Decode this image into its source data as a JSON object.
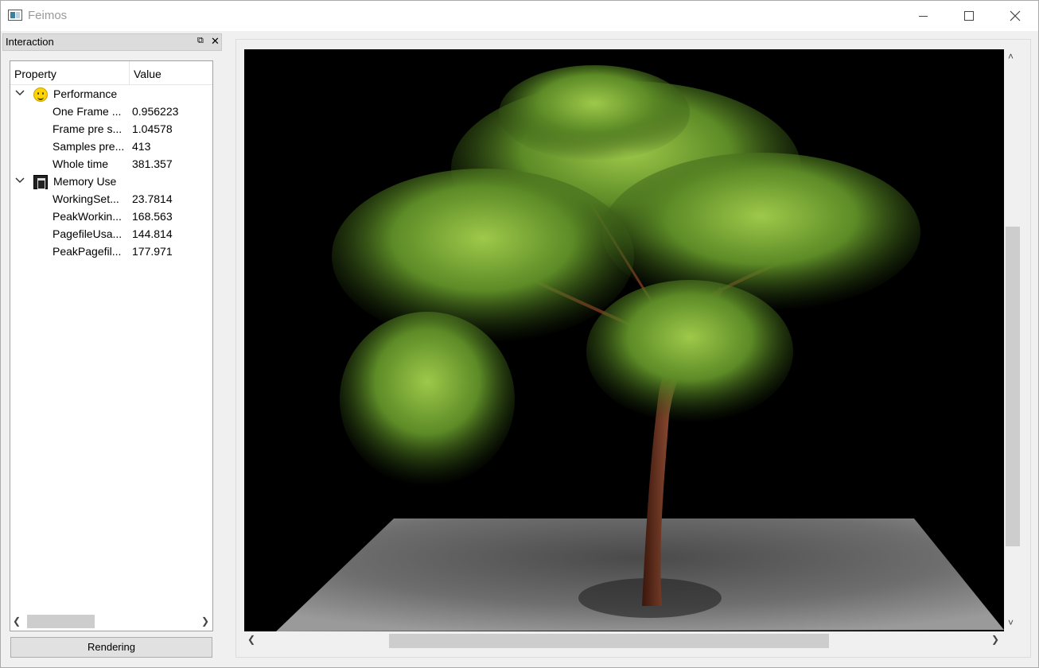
{
  "window": {
    "title": "Feimos"
  },
  "dock": {
    "title": "Interaction"
  },
  "tree": {
    "headers": {
      "property": "Property",
      "value": "Value"
    },
    "groups": [
      {
        "label": "Performance",
        "icon": "smiley-icon",
        "items": [
          {
            "label": "One Frame ...",
            "value": "0.956223"
          },
          {
            "label": "Frame pre s...",
            "value": "1.04578"
          },
          {
            "label": "Samples pre...",
            "value": "413"
          },
          {
            "label": "Whole time",
            "value": "381.357"
          }
        ]
      },
      {
        "label": "Memory Use",
        "icon": "memory-icon",
        "items": [
          {
            "label": "WorkingSet...",
            "value": "23.7814"
          },
          {
            "label": "PeakWorkin...",
            "value": "168.563"
          },
          {
            "label": "PagefileUsa...",
            "value": "144.814"
          },
          {
            "label": "PeakPagefil...",
            "value": "177.971"
          }
        ]
      }
    ]
  },
  "buttons": {
    "rendering": "Rendering"
  },
  "viewport": {
    "background": "#000000",
    "foliage_color": "#4a7a1f",
    "trunk_color": "#6b2e1c",
    "floor_color": "#8a8a8a"
  }
}
